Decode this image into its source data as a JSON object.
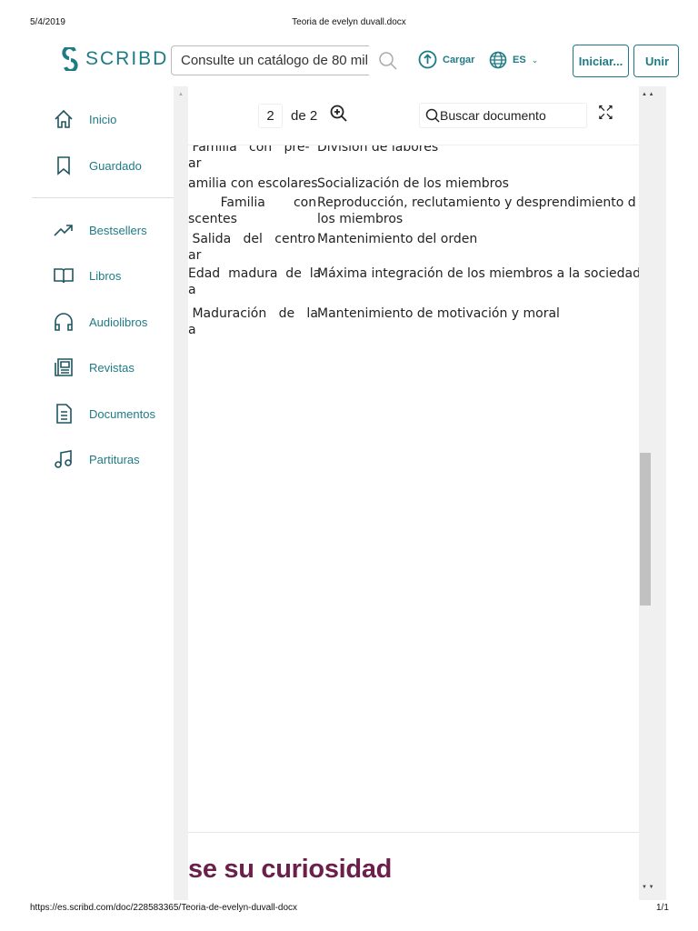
{
  "print_header": {
    "date": "5/4/2019",
    "title": "Teoria de evelyn duvall.docx"
  },
  "print_footer": {
    "url": "https://es.scribd.com/doc/228583365/Teoria-de-evelyn-duvall-docx",
    "page": "1/1"
  },
  "nav": {
    "logo": "SCRIBD",
    "search_placeholder": "Consulte un catálogo de 80 millo",
    "upload": "Cargar",
    "language": "ES",
    "login": "Iniciar...",
    "join": "Unir"
  },
  "sidebar": {
    "items": [
      {
        "label": "Inicio",
        "icon": "home-icon"
      },
      {
        "label": "Guardado",
        "icon": "bookmark-icon"
      },
      {
        "label": "Bestsellers",
        "icon": "trending-icon"
      },
      {
        "label": "Libros",
        "icon": "book-icon"
      },
      {
        "label": "Audiolibros",
        "icon": "headphones-icon"
      },
      {
        "label": "Revistas",
        "icon": "magazine-icon"
      },
      {
        "label": "Documentos",
        "icon": "document-icon"
      },
      {
        "label": "Partituras",
        "icon": "music-icon"
      }
    ]
  },
  "viewer": {
    "page": "2",
    "of": "de 2",
    "search_placeholder": "Buscar documento"
  },
  "document": {
    "rows": [
      {
        "c1a": " Familia   con   pre-",
        "c1b": "ar",
        "c2a": "División de labores",
        "c2b": ""
      },
      {
        "c1a": "amilia con escolares",
        "c1b": "",
        "c2a": "Socialización de los miembros",
        "c2b": ""
      },
      {
        "c1a": "        Familia       con",
        "c1b": "scentes",
        "c2a": "Reproducción, reclutamiento y desprendimiento d",
        "c2b": "los miembros"
      },
      {
        "c1a": " Salida   del   centro",
        "c1b": "ar",
        "c2a": "Mantenimiento del orden",
        "c2b": ""
      },
      {
        "c1a": "Edad  madura  de  la",
        "c1b": "a",
        "c2a": "Máxima integración de los miembros a la sociedad",
        "c2b": ""
      },
      {
        "c1a": " Maduración   de   la",
        "c1b": "a",
        "c2a": "Mantenimiento de motivación y moral",
        "c2b": ""
      }
    ]
  },
  "promo": {
    "text": "se su curiosidad"
  },
  "colors": {
    "brand": "#1e7b85",
    "promo": "#6b1f4b"
  }
}
